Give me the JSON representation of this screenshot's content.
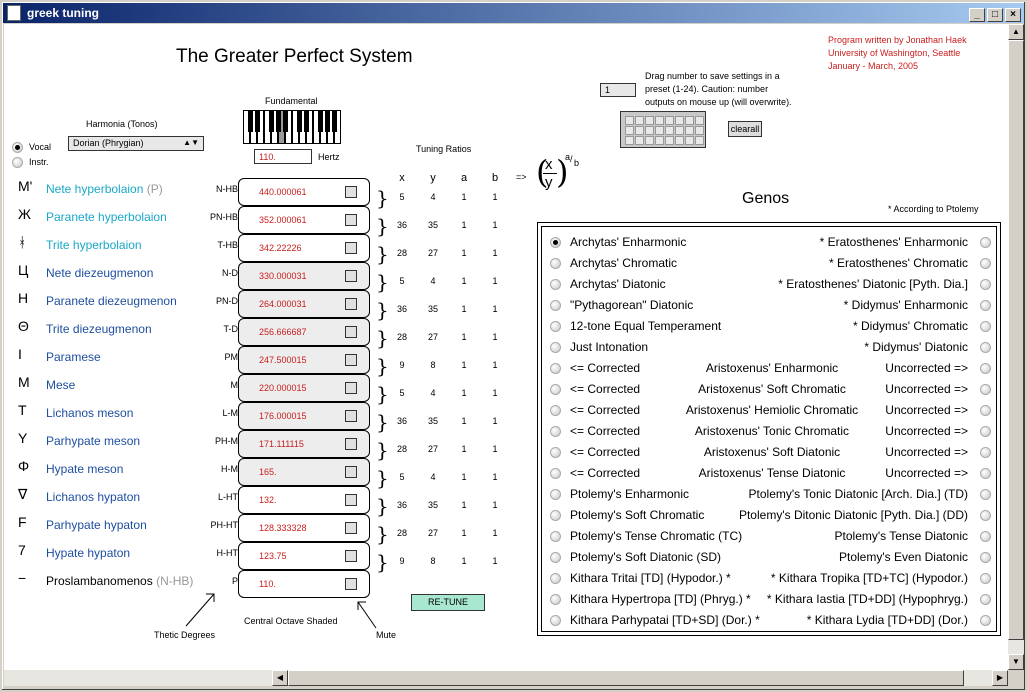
{
  "window": {
    "title": "greek tuning"
  },
  "title": "The Greater Perfect System",
  "credit": [
    "Program written by Jonathan Haek",
    "University of Washington, Seattle",
    "January - March, 2005"
  ],
  "harmonia": {
    "label": "Harmonia (Tonos)",
    "selected": "Dorian (Phrygian)"
  },
  "mode": {
    "vocal": "Vocal",
    "instr": "Instr."
  },
  "fundamental": {
    "label": "Fundamental",
    "value": "110.",
    "unit": "Hertz"
  },
  "preset": {
    "value": "1",
    "help": [
      "Drag number to save settings in a",
      "preset (1-24). Caution: number",
      "outputs on mouse up (will overwrite)."
    ],
    "clear": "clearall"
  },
  "tuning": {
    "label": "Tuning Ratios",
    "headers": [
      "x",
      "y",
      "a",
      "b"
    ],
    "arrow": "=>",
    "fx": "x",
    "fy": "y",
    "fa": "a",
    "fb": "b"
  },
  "ratios": [
    [
      "5",
      "4",
      "1",
      "1"
    ],
    [
      "36",
      "35",
      "1",
      "1"
    ],
    [
      "28",
      "27",
      "1",
      "1"
    ],
    [
      "5",
      "4",
      "1",
      "1"
    ],
    [
      "36",
      "35",
      "1",
      "1"
    ],
    [
      "28",
      "27",
      "1",
      "1"
    ],
    [
      "9",
      "8",
      "1",
      "1"
    ],
    [
      "5",
      "4",
      "1",
      "1"
    ],
    [
      "36",
      "35",
      "1",
      "1"
    ],
    [
      "28",
      "27",
      "1",
      "1"
    ],
    [
      "5",
      "4",
      "1",
      "1"
    ],
    [
      "36",
      "35",
      "1",
      "1"
    ],
    [
      "28",
      "27",
      "1",
      "1"
    ],
    [
      "9",
      "8",
      "1",
      "1"
    ]
  ],
  "notes": [
    {
      "sym": "Μ'",
      "name": "Nete hyperbolaion",
      "hint": "(P)",
      "abbr": "N-HB",
      "value": "440.000061",
      "color": "cyan"
    },
    {
      "sym": "Ж",
      "name": "Paranete hyperbolaion",
      "hint": "",
      "abbr": "PN-HB",
      "value": "352.000061",
      "color": "cyan"
    },
    {
      "sym": "ᚼ",
      "name": "Trite hyperbolaion",
      "hint": "",
      "abbr": "T-HB",
      "value": "342.22226",
      "color": "cyan"
    },
    {
      "sym": "Ц",
      "name": "Nete diezeugmenon",
      "hint": "",
      "abbr": "N-D",
      "value": "330.000031",
      "color": "blue"
    },
    {
      "sym": "Η",
      "name": "Paranete diezeugmenon",
      "hint": "",
      "abbr": "PN-D",
      "value": "264.000031",
      "color": "blue"
    },
    {
      "sym": "Θ",
      "name": "Trite diezeugmenon",
      "hint": "",
      "abbr": "T-D",
      "value": "256.666687",
      "color": "blue"
    },
    {
      "sym": "Ι",
      "name": "Paramese",
      "hint": "",
      "abbr": "PM",
      "value": "247.500015",
      "color": "blue"
    },
    {
      "sym": "Μ",
      "name": "Mese",
      "hint": "",
      "abbr": "M",
      "value": "220.000015",
      "color": "blue"
    },
    {
      "sym": "Τ",
      "name": "Lichanos meson",
      "hint": "",
      "abbr": "L-M",
      "value": "176.000015",
      "color": "blue"
    },
    {
      "sym": "Υ",
      "name": "Parhypate meson",
      "hint": "",
      "abbr": "PH-M",
      "value": "171.111115",
      "color": "blue"
    },
    {
      "sym": "Φ",
      "name": "Hypate meson",
      "hint": "",
      "abbr": "H-M",
      "value": "165.",
      "color": "blue"
    },
    {
      "sym": "∇",
      "name": "Lichanos hypaton",
      "hint": "",
      "abbr": "L-HT",
      "value": "132.",
      "color": "blue"
    },
    {
      "sym": "F",
      "name": "Parhypate hypaton",
      "hint": "",
      "abbr": "PH-HT",
      "value": "128.333328",
      "color": "blue"
    },
    {
      "sym": "7",
      "name": "Hypate hypaton",
      "hint": "",
      "abbr": "H-HT",
      "value": "123.75",
      "color": "blue"
    },
    {
      "sym": "−",
      "name": "Proslambanomenos",
      "hint": "(N-HB)",
      "abbr": "P",
      "value": "110.",
      "color": "black"
    }
  ],
  "labels": {
    "thetic": "Thetic Degrees",
    "central": "Central Octave Shaded",
    "mute": "Mute",
    "retune": "RE-TUNE"
  },
  "genos": {
    "title": "Genos",
    "note": "* According to Ptolemy",
    "rows": [
      {
        "l": "Archytas' Enharmonic",
        "c": "",
        "r": "* Eratosthenes' Enharmonic"
      },
      {
        "l": "Archytas' Chromatic",
        "c": "",
        "r": "* Eratosthenes' Chromatic"
      },
      {
        "l": "Archytas' Diatonic",
        "c": "",
        "r": "* Eratosthenes' Diatonic [Pyth. Dia.]"
      },
      {
        "l": "\"Pythagorean\" Diatonic",
        "c": "",
        "r": "* Didymus' Enharmonic"
      },
      {
        "l": "12-tone Equal Temperament",
        "c": "",
        "r": "* Didymus' Chromatic"
      },
      {
        "l": "Just Intonation",
        "c": "",
        "r": "* Didymus' Diatonic"
      },
      {
        "l": "<= Corrected",
        "c": "Aristoxenus' Enharmonic",
        "r": "Uncorrected =>"
      },
      {
        "l": "<= Corrected",
        "c": "Aristoxenus' Soft Chromatic",
        "r": "Uncorrected =>"
      },
      {
        "l": "<= Corrected",
        "c": "Aristoxenus' Hemiolic Chromatic",
        "r": "Uncorrected =>"
      },
      {
        "l": "<= Corrected",
        "c": "Aristoxenus' Tonic Chromatic",
        "r": "Uncorrected =>"
      },
      {
        "l": "<= Corrected",
        "c": "Aristoxenus' Soft Diatonic",
        "r": "Uncorrected =>"
      },
      {
        "l": "<= Corrected",
        "c": "Aristoxenus' Tense Diatonic",
        "r": "Uncorrected =>"
      },
      {
        "l": "Ptolemy's Enharmonic",
        "c": "",
        "r": "Ptolemy's Tonic Diatonic [Arch. Dia.] (TD)"
      },
      {
        "l": "Ptolemy's Soft Chromatic",
        "c": "",
        "r": "Ptolemy's Ditonic Diatonic [Pyth. Dia.] (DD)"
      },
      {
        "l": "Ptolemy's Tense Chromatic (TC)",
        "c": "",
        "r": "Ptolemy's Tense Diatonic"
      },
      {
        "l": "Ptolemy's Soft Diatonic (SD)",
        "c": "",
        "r": "Ptolemy's Even Diatonic"
      },
      {
        "l": "Kithara Tritai [TD] (Hypodor.) *",
        "c": "",
        "r": "* Kithara Tropika [TD+TC] (Hypodor.)"
      },
      {
        "l": "Kithara Hypertropa [TD] (Phryg.) *",
        "c": "",
        "r": "* Kithara Iastia [TD+DD] (Hypophryg.)"
      },
      {
        "l": "Kithara Parhypatai [TD+SD] (Dor.) *",
        "c": "",
        "r": "* Kithara Lydia [TD+DD] (Dor.)"
      }
    ]
  }
}
